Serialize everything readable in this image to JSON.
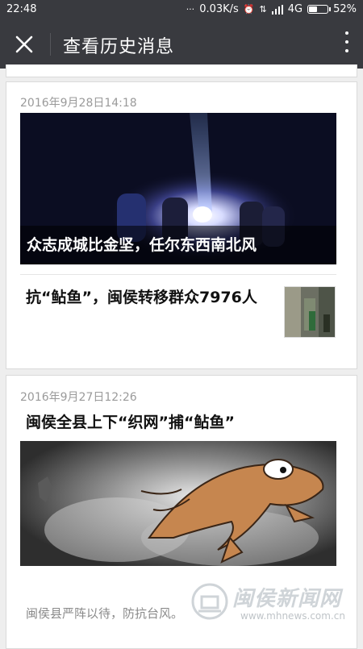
{
  "status_bar": {
    "time": "22:48",
    "network_speed": "0.03K/s",
    "network_type": "4G",
    "battery_percent": "52%",
    "battery_level": 0.52
  },
  "nav": {
    "title": "查看历史消息",
    "close_icon": "close-icon",
    "more_icon": "more-vertical-icon"
  },
  "messages": [
    {
      "date": "2016年9月28日14:18",
      "cover_caption": "众志成城比金坚，任尔东西南北风",
      "sub_title": "抗“鲇鱼”，闽侯转移群众7976人"
    },
    {
      "date": "2016年9月27日12:26",
      "title": "闽侯全县上下“织网”捕“鲇鱼”",
      "summary": "闽侯县严阵以待，防抗台风。"
    }
  ],
  "watermark": {
    "text": "闽侯新闻网",
    "url": "www.mhnews.com.cn"
  }
}
